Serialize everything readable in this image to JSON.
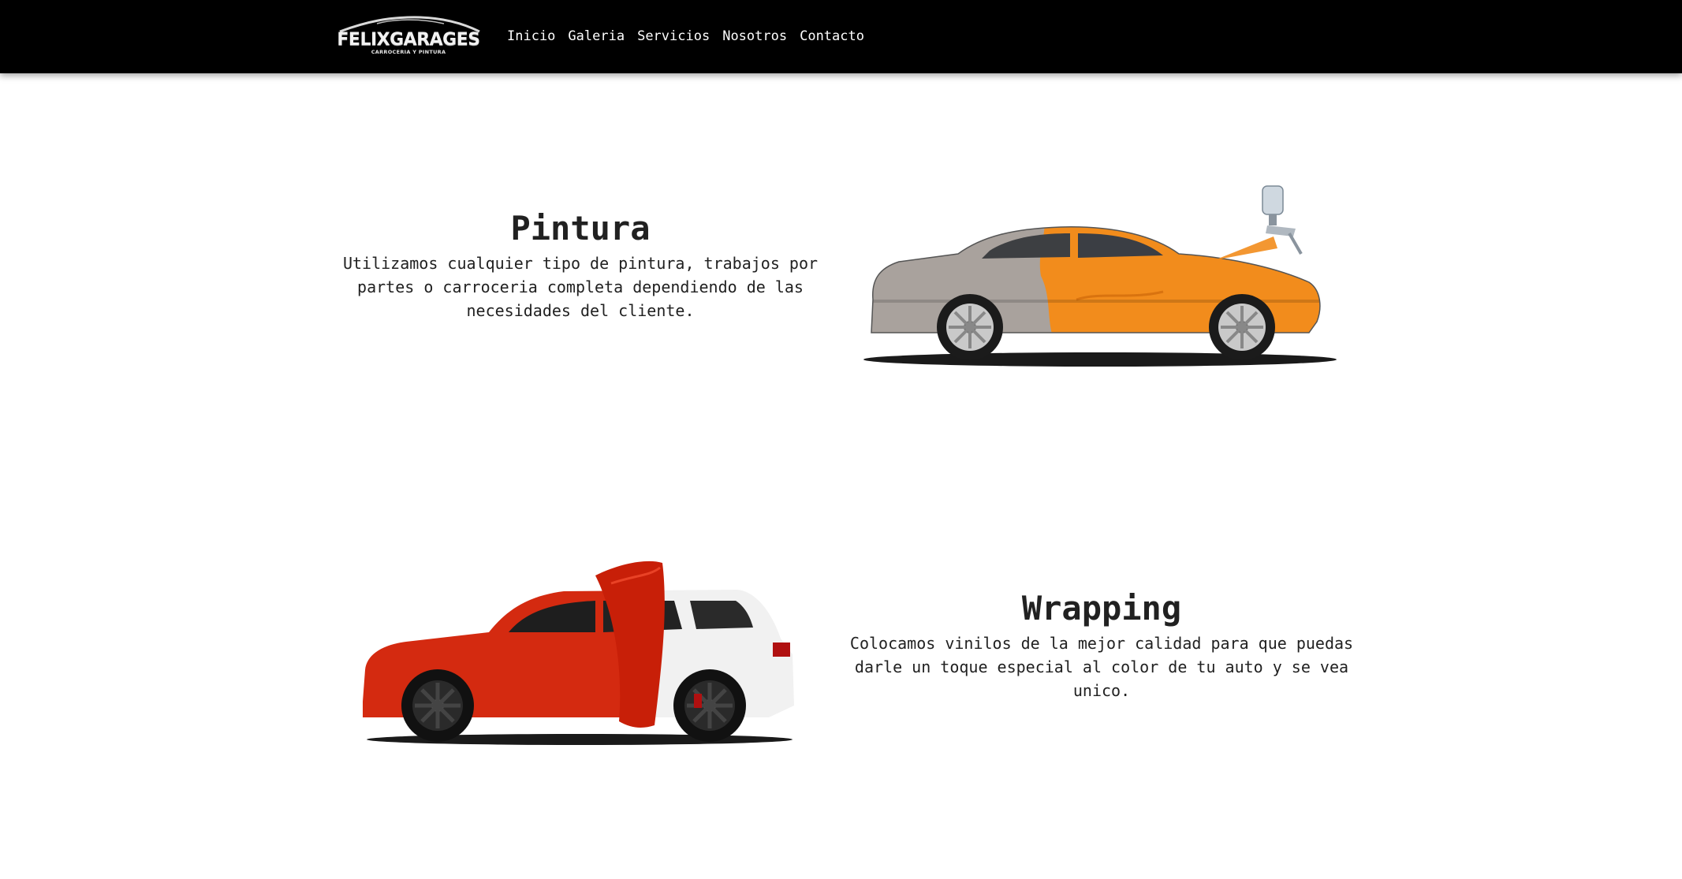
{
  "navbar": {
    "brand": {
      "name": "FELIXGARAGES",
      "subtitle": "CARROCERIA Y PINTURA"
    },
    "links": [
      "Inicio",
      "Galeria",
      "Servicios",
      "Nosotros",
      "Contacto"
    ]
  },
  "services": [
    {
      "title": "Pintura",
      "description": "Utilizamos cualquier tipo de pintura, trabajos por partes o carroceria completa dependiendo de las necesidades del cliente."
    },
    {
      "title": "Wrapping",
      "description": "Colocamos vinilos de la mejor calidad para que puedas darle un toque especial al color de tu auto y se vea unico."
    }
  ],
  "colors": {
    "navbar_bg": "#000000",
    "paint_orange": "#f28c1c",
    "wrap_red": "#d42a10",
    "car_silver": "#a9a29d",
    "car_white": "#f1f1f1"
  },
  "icons": {
    "logo": "car-silhouette-logo",
    "paint": "spray-gun-icon"
  }
}
